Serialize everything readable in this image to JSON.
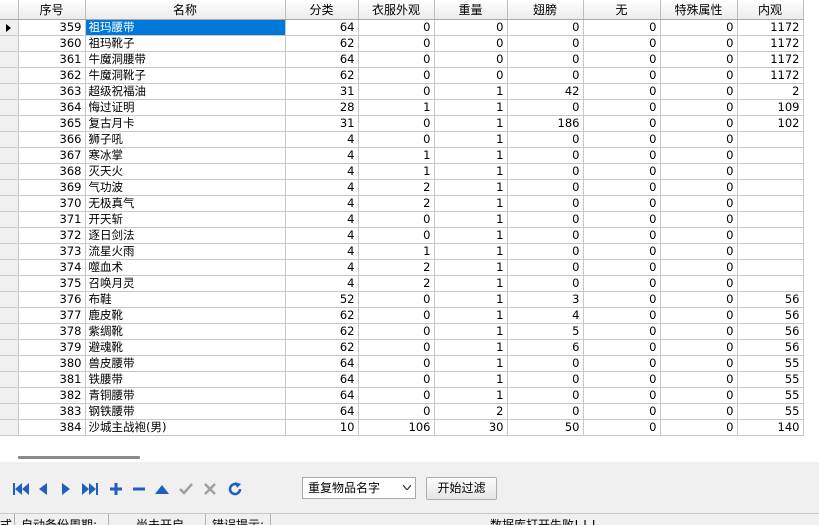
{
  "columns": [
    "",
    "序号",
    "名称",
    "分类",
    "衣服外观",
    "重量",
    "翅膀",
    "无",
    "特殊属性",
    "内观"
  ],
  "rows": [
    [
      "359",
      "祖玛腰带",
      "64",
      "0",
      "0",
      "0",
      "0",
      "0",
      "1172"
    ],
    [
      "360",
      "祖玛靴子",
      "62",
      "0",
      "0",
      "0",
      "0",
      "0",
      "1172"
    ],
    [
      "361",
      "牛魔洞腰带",
      "64",
      "0",
      "0",
      "0",
      "0",
      "0",
      "1172"
    ],
    [
      "362",
      "牛魔洞靴子",
      "62",
      "0",
      "0",
      "0",
      "0",
      "0",
      "1172"
    ],
    [
      "363",
      "超级祝福油",
      "31",
      "0",
      "1",
      "42",
      "0",
      "0",
      "2"
    ],
    [
      "364",
      "悔过证明",
      "28",
      "1",
      "1",
      "0",
      "0",
      "0",
      "109"
    ],
    [
      "365",
      "复古月卡",
      "31",
      "0",
      "1",
      "186",
      "0",
      "0",
      "102"
    ],
    [
      "366",
      "狮子吼",
      "4",
      "0",
      "1",
      "0",
      "0",
      "0",
      ""
    ],
    [
      "367",
      "寒冰掌",
      "4",
      "1",
      "1",
      "0",
      "0",
      "0",
      ""
    ],
    [
      "368",
      "灭天火",
      "4",
      "1",
      "1",
      "0",
      "0",
      "0",
      ""
    ],
    [
      "369",
      "气功波",
      "4",
      "2",
      "1",
      "0",
      "0",
      "0",
      ""
    ],
    [
      "370",
      "无极真气",
      "4",
      "2",
      "1",
      "0",
      "0",
      "0",
      ""
    ],
    [
      "371",
      "开天斩",
      "4",
      "0",
      "1",
      "0",
      "0",
      "0",
      ""
    ],
    [
      "372",
      "逐日剑法",
      "4",
      "0",
      "1",
      "0",
      "0",
      "0",
      ""
    ],
    [
      "373",
      "流星火雨",
      "4",
      "1",
      "1",
      "0",
      "0",
      "0",
      ""
    ],
    [
      "374",
      "噬血术",
      "4",
      "2",
      "1",
      "0",
      "0",
      "0",
      ""
    ],
    [
      "375",
      "召唤月灵",
      "4",
      "2",
      "1",
      "0",
      "0",
      "0",
      ""
    ],
    [
      "376",
      "布鞋",
      "52",
      "0",
      "1",
      "3",
      "0",
      "0",
      "56"
    ],
    [
      "377",
      "鹿皮靴",
      "62",
      "0",
      "1",
      "4",
      "0",
      "0",
      "56"
    ],
    [
      "378",
      "紫绸靴",
      "62",
      "0",
      "1",
      "5",
      "0",
      "0",
      "56"
    ],
    [
      "379",
      "避魂靴",
      "62",
      "0",
      "1",
      "6",
      "0",
      "0",
      "56"
    ],
    [
      "380",
      "兽皮腰带",
      "64",
      "0",
      "1",
      "0",
      "0",
      "0",
      "55"
    ],
    [
      "381",
      "铁腰带",
      "64",
      "0",
      "1",
      "0",
      "0",
      "0",
      "55"
    ],
    [
      "382",
      "青铜腰带",
      "64",
      "0",
      "1",
      "0",
      "0",
      "0",
      "55"
    ],
    [
      "383",
      "钢铁腰带",
      "64",
      "0",
      "2",
      "0",
      "0",
      "0",
      "55"
    ],
    [
      "384",
      "沙城主战袍(男)",
      "10",
      "106",
      "30",
      "50",
      "0",
      "0",
      "140"
    ]
  ],
  "selected_row": 0,
  "navigator": {
    "buttons": [
      "first-record",
      "prior-record",
      "next-record",
      "last-record",
      "insert-record",
      "delete-record",
      "edit-record",
      "post-edit",
      "cancel-edit",
      "refresh-data"
    ],
    "color": "#1f5fbf",
    "disabled_color": "#a0a0a0"
  },
  "filter": {
    "selected": "重复物品名字",
    "button_label": "开始过滤"
  },
  "statusbar": {
    "cell1": "式",
    "cell2": "自动备份周期:",
    "cell3": "尚未开启",
    "cell4": "错误提示:",
    "cell5": "数据库打开失败! ! !"
  },
  "colors": {
    "selection": "#0078d7",
    "grid_line": "#c8c8c8"
  }
}
